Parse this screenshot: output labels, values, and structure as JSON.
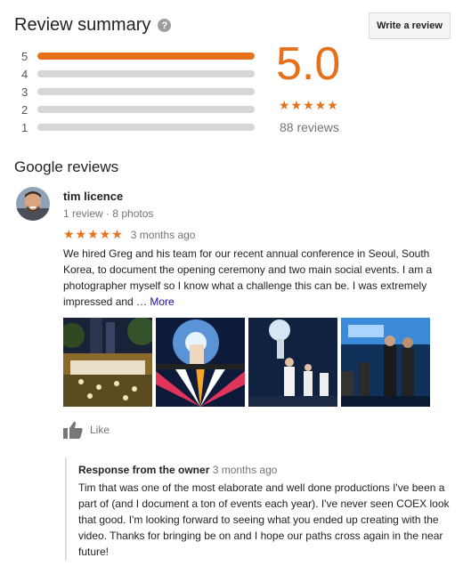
{
  "summary": {
    "title": "Review summary",
    "help_icon": "?",
    "write_review_label": "Write a review",
    "rating_value": "5.0",
    "stars": "★★★★★",
    "review_count": "88 reviews",
    "distribution": [
      {
        "label": "5",
        "fraction": 1.0
      },
      {
        "label": "4",
        "fraction": 0.0
      },
      {
        "label": "3",
        "fraction": 0.0
      },
      {
        "label": "2",
        "fraction": 0.0
      },
      {
        "label": "1",
        "fraction": 0.0
      }
    ]
  },
  "reviews_section": {
    "title": "Google reviews"
  },
  "review": {
    "author": "tim licence",
    "meta": "1 review · 8 photos",
    "stars": "★★★★★",
    "date": "3 months ago",
    "text": "We hired Greg and his team for our recent annual conference in Seoul, South Korea, to document the opening ceremony and two main social events. I am a photographer myself so I know what a challenge this can be. I was extremely impressed and … ",
    "more_label": "More",
    "like_label": "Like"
  },
  "owner_response": {
    "label": "Response from the owner",
    "date": "3 months ago",
    "text": "Tim that was one of the most elaborate and well done productions I've been a part of (and I document a ton of events each year). I've never seen COEX look that good. I'm looking forward to seeing what you ended up creating with the video. Thanks for bringing be on and I hope our paths cross again in the near future!"
  },
  "colors": {
    "accent": "#e7711b",
    "link": "#1a0dab",
    "muted": "#70757a",
    "track": "#d6d6d6"
  },
  "icons": {
    "help": "help-icon",
    "like": "thumbs-up-icon"
  }
}
